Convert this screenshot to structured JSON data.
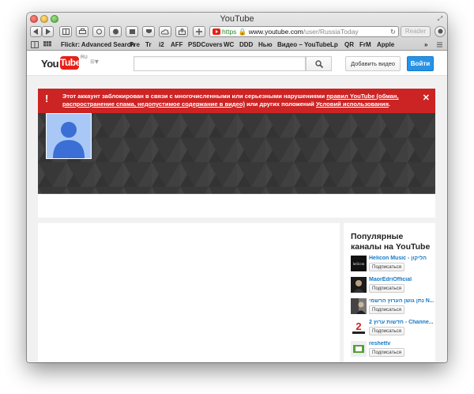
{
  "window": {
    "title": "YouTube"
  },
  "toolbar": {
    "address": {
      "scheme": "https",
      "domain": "www.youtube.com",
      "path": "/user/RussiaToday"
    },
    "reader_label": "Reader"
  },
  "bookmarks": [
    {
      "label": "Flickr: Advanced Search"
    },
    {
      "label": "Pre"
    },
    {
      "label": "Tr"
    },
    {
      "label": "i2"
    },
    {
      "label": "AFF"
    },
    {
      "label": "PSDCovers"
    },
    {
      "label": "WC"
    },
    {
      "label": "DDD"
    },
    {
      "label": "Нью"
    },
    {
      "label": "Видео – YouTube"
    },
    {
      "label": "Lp"
    },
    {
      "label": "QR"
    },
    {
      "label": "FrM"
    },
    {
      "label": "Apple"
    }
  ],
  "youtube": {
    "logo_you": "You",
    "logo_tube": "Tube",
    "logo_region": "RU",
    "search_placeholder": "",
    "upload_label": "Добавить видео",
    "signin_label": "Войти",
    "alert": {
      "text_before": "Этот аккаунт заблокирован в связи с многочисленными или серьезными нарушениями ",
      "link1": "правил YouTube (обман, распространение спама, недопустимое содержание в видео)",
      "text_middle": " или других положений ",
      "link2": "Условий использования",
      "text_after": "."
    },
    "sidebar": {
      "title": "Популярные каналы на YouTube",
      "subscribe_label": "Подписаться",
      "channels": [
        {
          "name": "Helicon Music - הליקון"
        },
        {
          "name": "MaorEdriOfficial"
        },
        {
          "name": "נתן גושן הערוץ הרשמי N..."
        },
        {
          "name": "חדשות ערוץ 2 - Channe..."
        },
        {
          "name": "reshettv"
        }
      ]
    }
  },
  "colors": {
    "alert_red": "#cc2424",
    "signin_blue": "#2793e6",
    "link_blue": "#167ac6",
    "youtube_red": "#e62117",
    "avatar_blue": "#aac8f5",
    "avatar_figure": "#3b6fd6"
  }
}
